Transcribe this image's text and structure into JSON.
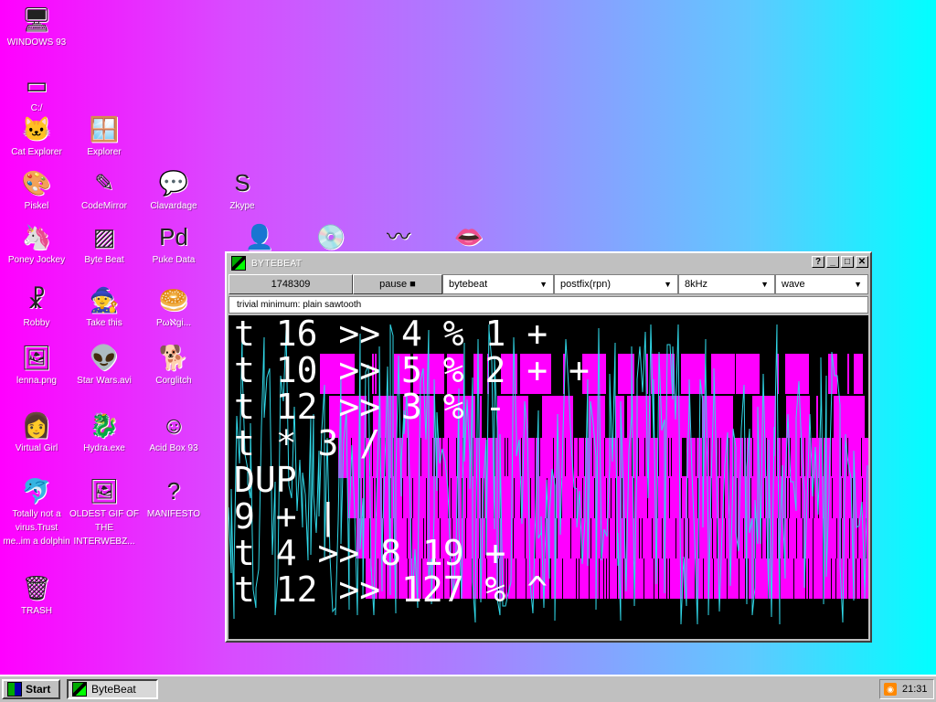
{
  "desktop": {
    "icons": [
      {
        "label": "WINDOWS 93",
        "glyph": "🖥",
        "icon": "computer-icon"
      },
      {
        "label": "C:/",
        "glyph": "▭",
        "icon": "drive-icon"
      },
      {
        "label": "Cat Explorer",
        "glyph": "🐱",
        "icon": "cat-explorer-icon"
      },
      {
        "label": "Explorer",
        "glyph": "🪟",
        "icon": "explorer-icon"
      },
      {
        "label": "Piskel",
        "glyph": "🎨",
        "icon": "piskel-icon"
      },
      {
        "label": "CodeMirror",
        "glyph": "✎",
        "icon": "codemirror-icon"
      },
      {
        "label": "Clavardage",
        "glyph": "💬",
        "icon": "clavardage-icon"
      },
      {
        "label": "Zkype",
        "glyph": "S",
        "icon": "zkype-icon"
      },
      {
        "label": "Poney Jockey",
        "glyph": "🦄",
        "icon": "poney-jockey-icon"
      },
      {
        "label": "Byte Beat",
        "glyph": "▨",
        "icon": "bytebeat-icon"
      },
      {
        "label": "Puke Data",
        "glyph": "Pd",
        "icon": "puke-data-icon"
      },
      {
        "label": "Robby",
        "glyph": "☧",
        "icon": "robby-icon"
      },
      {
        "label": "Take this",
        "glyph": "🧙",
        "icon": "take-this-icon"
      },
      {
        "label": "Pωℵgi...",
        "glyph": "🥯",
        "icon": "pongi-icon"
      },
      {
        "label": "lenna.png",
        "glyph": "🖼",
        "icon": "image-file-icon"
      },
      {
        "label": "Star Wars.avi",
        "glyph": "👽",
        "icon": "star-wars-icon"
      },
      {
        "label": "Corglitch",
        "glyph": "🐕",
        "icon": "corglitch-icon"
      },
      {
        "label": "Virtual Girl",
        "glyph": "👩",
        "icon": "virtual-girl-icon"
      },
      {
        "label": "Hydra.exe",
        "glyph": "🐉",
        "icon": "hydra-icon"
      },
      {
        "label": "Acid Box 93",
        "glyph": "☺",
        "icon": "acid-box-icon"
      },
      {
        "label": "Totally not a virus.Trust me..im a dolphin",
        "glyph": "🐬",
        "icon": "dolphin-icon"
      },
      {
        "label": "OLDEST GIF OF THE INTERWEBZ...",
        "glyph": "🖼",
        "icon": "gif-file-icon"
      },
      {
        "label": "MANIFESTO",
        "glyph": "?",
        "icon": "manifesto-icon"
      },
      {
        "label": "TRASH",
        "glyph": "🗑",
        "icon": "trash-icon"
      }
    ],
    "partial_icons": [
      {
        "glyph": "👤",
        "icon": "face-icon"
      },
      {
        "glyph": "💿",
        "icon": "music-icon"
      },
      {
        "glyph": "〰",
        "icon": "wave-icon"
      },
      {
        "glyph": "👄",
        "icon": "lips-icon"
      }
    ]
  },
  "window": {
    "title": "BYTEBEAT",
    "buttons": {
      "help": "?",
      "minimize": "_",
      "maximize": "□",
      "close": "✕"
    },
    "counter": "1748309",
    "pause_label": "pause ■",
    "mode": "bytebeat",
    "notation": "postfix(rpn)",
    "rate": "8kHz",
    "view": "wave",
    "description": "trivial minimum: plain sawtooth",
    "code_lines": [
      "t 16 >> 4 % 1 +",
      "t 10 >> 5 % 2 + +",
      "t 12 >> 3 % -",
      "t * 3 /",
      "DUP",
      "9 + |",
      "t 4 >> 8 19 +",
      "t 12 >> 127 % ^"
    ]
  },
  "colors": {
    "wave_magenta": "#ff00ff",
    "wave_cyan": "#30d8e8",
    "desktop_left": "#ff00ff",
    "desktop_right": "#00ffff"
  },
  "taskbar": {
    "start_label": "Start",
    "task_label": "ByteBeat",
    "clock": "21:31"
  }
}
